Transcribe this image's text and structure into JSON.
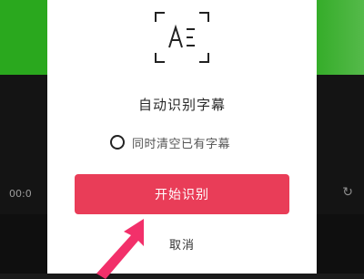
{
  "dialog": {
    "title": "自动识别字幕",
    "clear_option_label": "同时清空已有字幕",
    "clear_option_checked": false,
    "start_button_label": "开始识别",
    "cancel_label": "取消",
    "icon": "subtitle-recognition-icon",
    "accent_color": "#e93d58"
  },
  "background": {
    "time_text": "00:0",
    "redo_icon": "redo-icon"
  },
  "annotation": {
    "pointer": "pink-arrow-icon"
  }
}
